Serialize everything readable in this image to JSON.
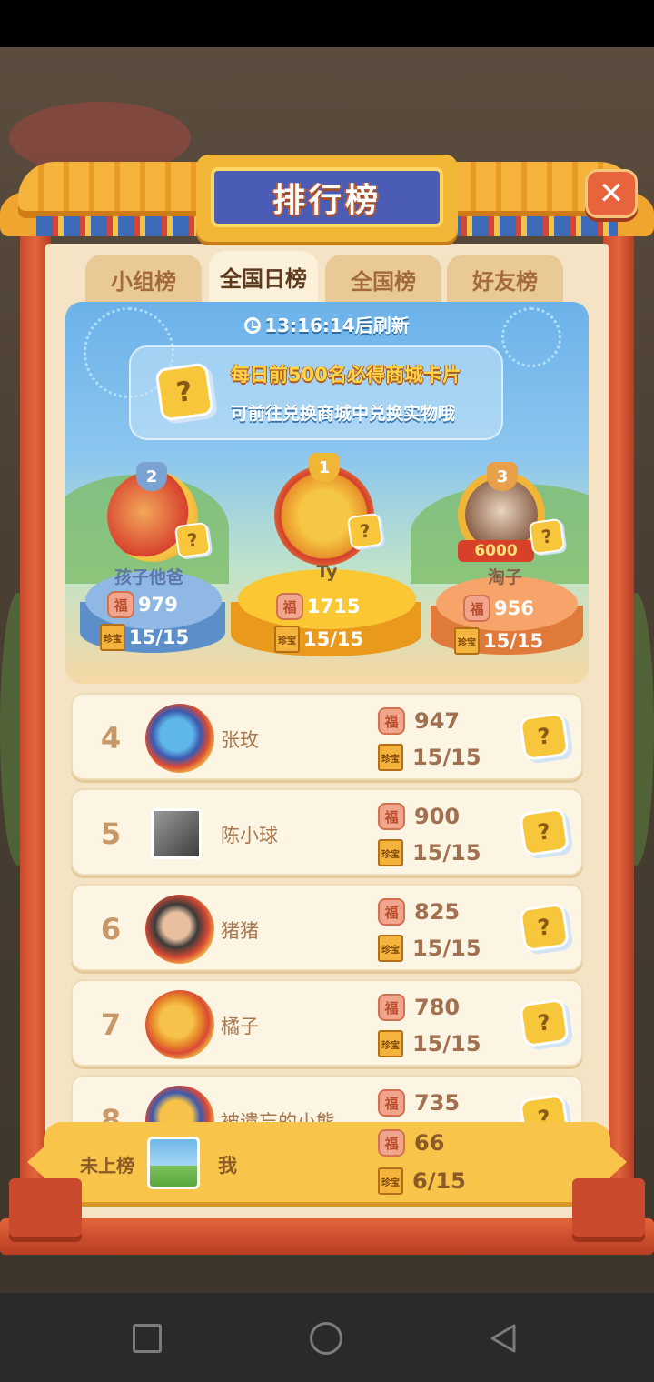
{
  "title": "排行榜",
  "tabs": [
    {
      "label": "小组榜",
      "active": false
    },
    {
      "label": "全国日榜",
      "active": true
    },
    {
      "label": "全国榜",
      "active": false
    },
    {
      "label": "好友榜",
      "active": false
    }
  ],
  "hero": {
    "refresh_text": "13:16:14后刷新",
    "notice_line1": "每日前500名必得商城卡片",
    "notice_line2": "可前往兑换商城中兑换实物哦"
  },
  "top3": [
    {
      "rank": "2",
      "name": "孩子他爸",
      "score": "979",
      "cards": "15/15"
    },
    {
      "rank": "1",
      "name": "Ty",
      "score": "1715",
      "cards": "15/15"
    },
    {
      "rank": "3",
      "name": "淘子",
      "score": "956",
      "cards": "15/15",
      "frame_label": "6000"
    }
  ],
  "list": [
    {
      "rank": "4",
      "name": "张玫",
      "score": "947",
      "cards": "15/15"
    },
    {
      "rank": "5",
      "name": "陈小球",
      "score": "900",
      "cards": "15/15"
    },
    {
      "rank": "6",
      "name": "猪猪",
      "score": "825",
      "cards": "15/15"
    },
    {
      "rank": "7",
      "name": "橘子",
      "score": "780",
      "cards": "15/15"
    },
    {
      "rank": "8",
      "name": "被遗忘的小熊",
      "score": "735",
      "cards": ""
    }
  ],
  "me": {
    "rank_label": "未上榜",
    "name": "我",
    "score": "66",
    "cards": "6/15"
  },
  "icons": {
    "fu": "福",
    "book": "珍宝",
    "question": "?",
    "close": "✕"
  },
  "colors": {
    "accent": "#f8c54a",
    "title_plate": "#4a5cb3",
    "frame_red": "#c94a2c"
  }
}
